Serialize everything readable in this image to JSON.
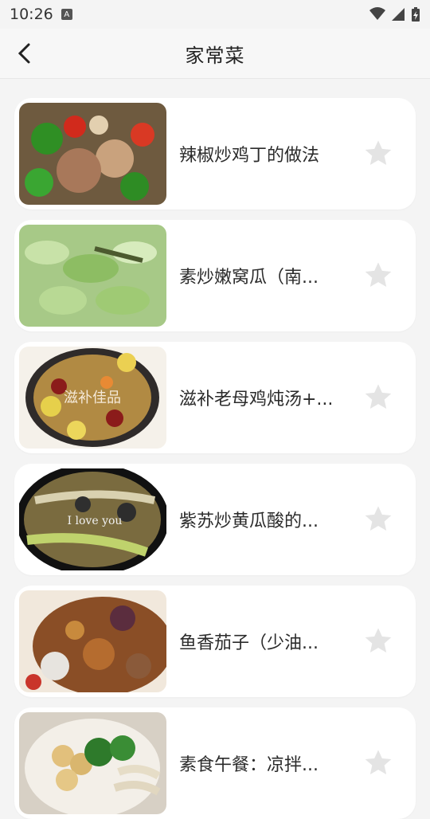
{
  "status": {
    "time": "10:26",
    "icons": [
      "a-icon",
      "wifi-icon",
      "cell-signal-icon",
      "battery-charging-icon"
    ]
  },
  "header": {
    "title": "家常菜",
    "back_icon": "chevron-left-icon"
  },
  "recipes": [
    {
      "name": "辣椒炒鸡丁的做法",
      "favorited": false
    },
    {
      "name": "素炒嫩窝瓜（南...",
      "favorited": false
    },
    {
      "name": "滋补老母鸡炖汤+...",
      "favorited": false,
      "image_text": "滋补佳品"
    },
    {
      "name": "紫苏炒黄瓜酸的...",
      "favorited": false,
      "image_text": "I love you"
    },
    {
      "name": "鱼香茄子（少油...",
      "favorited": false
    },
    {
      "name": "素食午餐：凉拌...",
      "favorited": false
    }
  ],
  "colors": {
    "background": "#f4f4f4",
    "card": "#ffffff",
    "star": "#e4e4e4"
  }
}
